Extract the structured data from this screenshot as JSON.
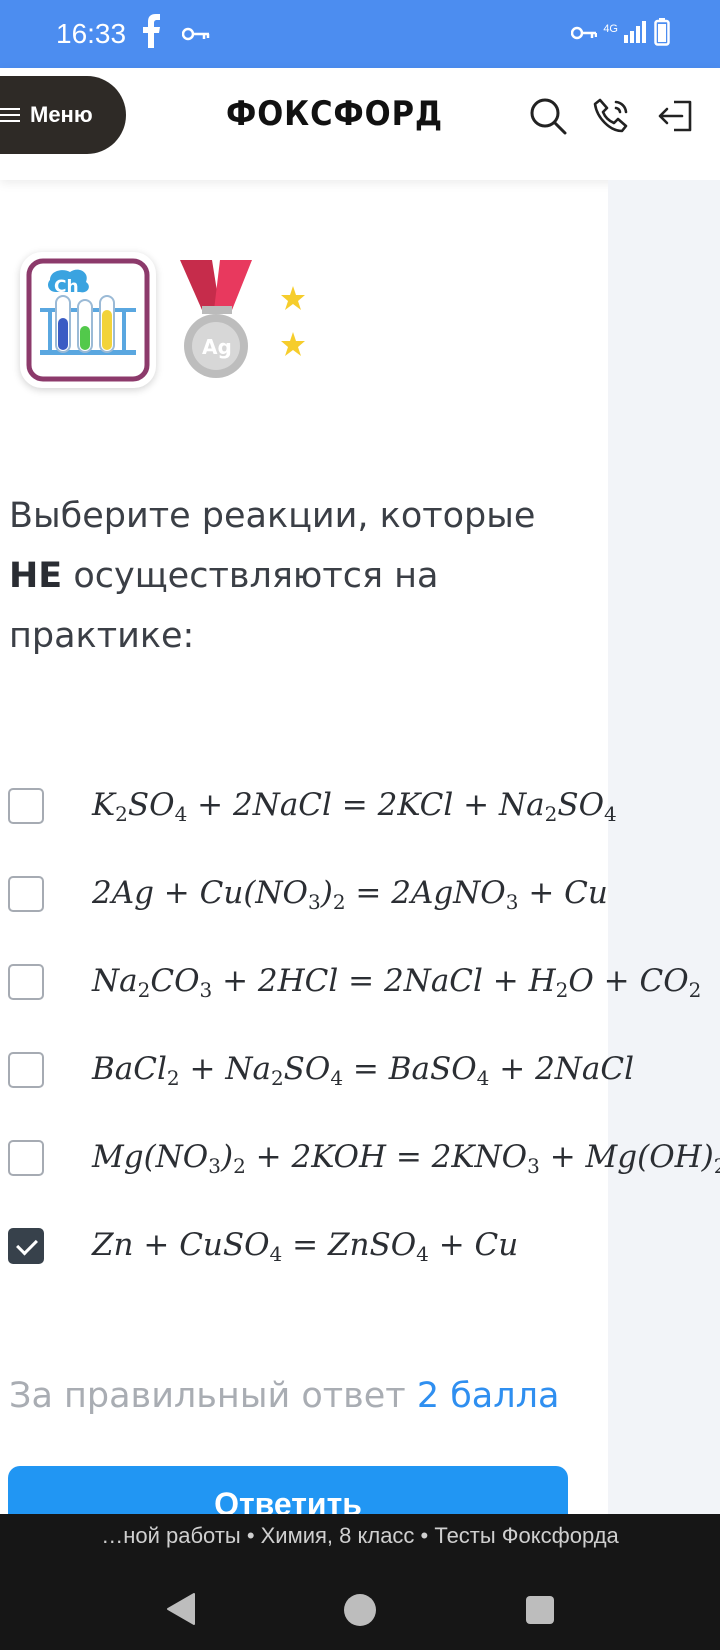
{
  "status_bar": {
    "time": "16:33",
    "network": "4G",
    "icons": [
      "facebook-icon",
      "key-icon",
      "vpn-key-icon",
      "signal-icon",
      "battery-icon"
    ]
  },
  "header": {
    "menu_label": "Меню",
    "logo": "ФОКСФОРД",
    "icons": [
      "search-icon",
      "phone-icon",
      "logout-icon"
    ]
  },
  "badges": {
    "chem_label": "Ch",
    "medal_label": "Ag"
  },
  "question": {
    "line1": "Выберите реакции, которые",
    "bold": "НЕ",
    "rest": " осуществляются на",
    "line3": "практике:"
  },
  "options": [
    {
      "checked": false
    },
    {
      "checked": false
    },
    {
      "checked": false
    },
    {
      "checked": false
    },
    {
      "checked": false
    },
    {
      "checked": true
    }
  ],
  "score": {
    "prefix": "За правильный ответ ",
    "points": "2 балла"
  },
  "answer_button": "Ответить",
  "bottom_title": "…ной работы • Химия, 8 класс • Тесты Фоксфорда",
  "colors": {
    "status_bar": "#4c8df0",
    "primary": "#2196f3",
    "menu_bg": "#2e2a26"
  }
}
